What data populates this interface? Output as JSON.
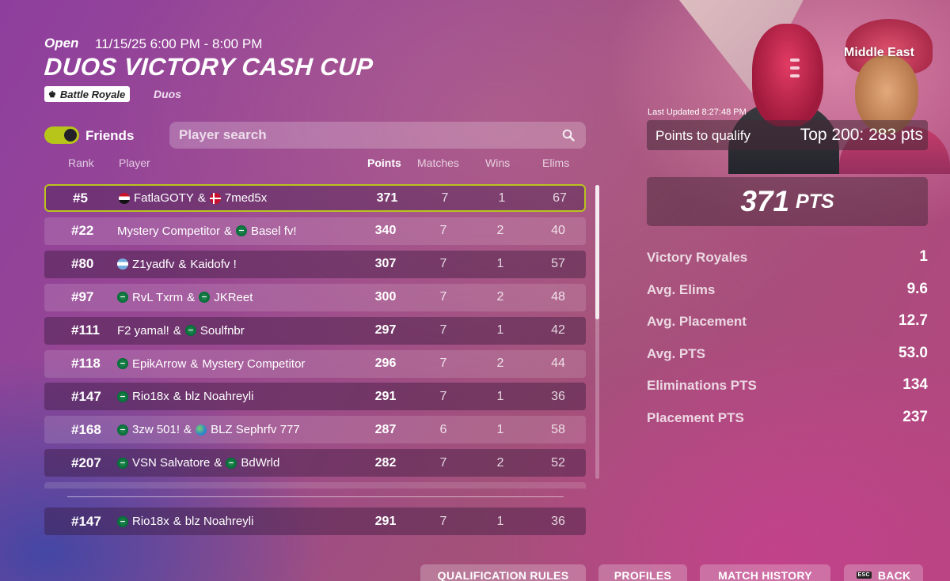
{
  "event": {
    "status": "Open",
    "datetime": "11/15/25 6:00 PM - 8:00 PM",
    "title": "DUOS VICTORY CASH CUP",
    "mode": "Battle Royale",
    "type": "Duos"
  },
  "filters": {
    "friends_label": "Friends",
    "friends_on": true,
    "search_placeholder": "Player search"
  },
  "table": {
    "headers": {
      "rank": "Rank",
      "player": "Player",
      "points": "Points",
      "matches": "Matches",
      "wins": "Wins",
      "elims": "Elims"
    },
    "rows": [
      {
        "rank": "#5",
        "p1": "FatlaGOTY",
        "p1_flag": "eg",
        "p2": "7med5x",
        "p2_flag": "dk",
        "points": "371",
        "matches": "7",
        "wins": "1",
        "elims": "67",
        "style": "me"
      },
      {
        "rank": "#22",
        "p1": "Mystery Competitor",
        "p1_flag": "",
        "p2": "Basel fv!",
        "p2_flag": "sa",
        "points": "340",
        "matches": "7",
        "wins": "2",
        "elims": "40",
        "style": "light"
      },
      {
        "rank": "#80",
        "p1": "Z1yadfv",
        "p1_flag": "ar",
        "p2": "Kaidofv !",
        "p2_flag": "",
        "points": "307",
        "matches": "7",
        "wins": "1",
        "elims": "57",
        "style": "dark"
      },
      {
        "rank": "#97",
        "p1": "RvL Txrm",
        "p1_flag": "sa",
        "p2": "JKReet",
        "p2_flag": "sa",
        "points": "300",
        "matches": "7",
        "wins": "2",
        "elims": "48",
        "style": "light"
      },
      {
        "rank": "#111",
        "p1": "F2 yamal!",
        "p1_flag": "",
        "p2": "Soulfnbr",
        "p2_flag": "sa",
        "points": "297",
        "matches": "7",
        "wins": "1",
        "elims": "42",
        "style": "dark"
      },
      {
        "rank": "#118",
        "p1": "EpikArrow",
        "p1_flag": "sa",
        "p2": "Mystery Competitor",
        "p2_flag": "",
        "points": "296",
        "matches": "7",
        "wins": "2",
        "elims": "44",
        "style": "light"
      },
      {
        "rank": "#147",
        "p1": "Rio18x",
        "p1_flag": "sa",
        "p2": "blz Noahreyli",
        "p2_flag": "",
        "points": "291",
        "matches": "7",
        "wins": "1",
        "elims": "36",
        "style": "dark"
      },
      {
        "rank": "#168",
        "p1": "3zw 501!",
        "p1_flag": "sa",
        "p2": "BLZ Sephrfv 777",
        "p2_flag": "globe",
        "points": "287",
        "matches": "6",
        "wins": "1",
        "elims": "58",
        "style": "light"
      },
      {
        "rank": "#207",
        "p1": "VSN Salvatore",
        "p1_flag": "sa",
        "p2": "BdWrld",
        "p2_flag": "sa",
        "points": "282",
        "matches": "7",
        "wins": "2",
        "elims": "52",
        "style": "dark"
      }
    ],
    "self_row": {
      "rank": "#147",
      "p1": "Rio18x",
      "p1_flag": "sa",
      "p2": "blz Noahreyli",
      "p2_flag": "",
      "points": "291",
      "matches": "7",
      "wins": "1",
      "elims": "36"
    }
  },
  "panel": {
    "region": "Middle East",
    "last_updated": "Last Updated 8:27:48 PM",
    "qualify_label": "Points to qualify",
    "qualify_value": "Top 200: 283 pts",
    "total_points": "371",
    "total_points_unit": "PTS",
    "stats": [
      {
        "label": "Victory Royales",
        "value": "1"
      },
      {
        "label": "Avg. Elims",
        "value": "9.6"
      },
      {
        "label": "Avg. Placement",
        "value": "12.7"
      },
      {
        "label": "Avg. PTS",
        "value": "53.0"
      },
      {
        "label": "Eliminations PTS",
        "value": "134"
      },
      {
        "label": "Placement PTS",
        "value": "237"
      }
    ]
  },
  "buttons": {
    "qualification_rules": "QUALIFICATION RULES",
    "profiles": "PROFILES",
    "match_history": "MATCH HISTORY",
    "back": "BACK",
    "back_key": "ESC"
  },
  "colors": {
    "accent": "#b9c41d"
  }
}
